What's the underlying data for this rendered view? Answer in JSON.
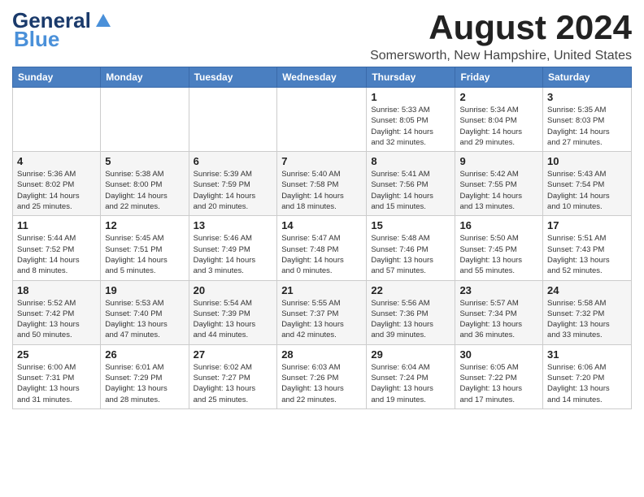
{
  "header": {
    "logo_line1": "General",
    "logo_line2": "Blue",
    "month": "August 2024",
    "location": "Somersworth, New Hampshire, United States"
  },
  "days_of_week": [
    "Sunday",
    "Monday",
    "Tuesday",
    "Wednesday",
    "Thursday",
    "Friday",
    "Saturday"
  ],
  "weeks": [
    [
      {
        "day": "",
        "info": ""
      },
      {
        "day": "",
        "info": ""
      },
      {
        "day": "",
        "info": ""
      },
      {
        "day": "",
        "info": ""
      },
      {
        "day": "1",
        "info": "Sunrise: 5:33 AM\nSunset: 8:05 PM\nDaylight: 14 hours\nand 32 minutes."
      },
      {
        "day": "2",
        "info": "Sunrise: 5:34 AM\nSunset: 8:04 PM\nDaylight: 14 hours\nand 29 minutes."
      },
      {
        "day": "3",
        "info": "Sunrise: 5:35 AM\nSunset: 8:03 PM\nDaylight: 14 hours\nand 27 minutes."
      }
    ],
    [
      {
        "day": "4",
        "info": "Sunrise: 5:36 AM\nSunset: 8:02 PM\nDaylight: 14 hours\nand 25 minutes."
      },
      {
        "day": "5",
        "info": "Sunrise: 5:38 AM\nSunset: 8:00 PM\nDaylight: 14 hours\nand 22 minutes."
      },
      {
        "day": "6",
        "info": "Sunrise: 5:39 AM\nSunset: 7:59 PM\nDaylight: 14 hours\nand 20 minutes."
      },
      {
        "day": "7",
        "info": "Sunrise: 5:40 AM\nSunset: 7:58 PM\nDaylight: 14 hours\nand 18 minutes."
      },
      {
        "day": "8",
        "info": "Sunrise: 5:41 AM\nSunset: 7:56 PM\nDaylight: 14 hours\nand 15 minutes."
      },
      {
        "day": "9",
        "info": "Sunrise: 5:42 AM\nSunset: 7:55 PM\nDaylight: 14 hours\nand 13 minutes."
      },
      {
        "day": "10",
        "info": "Sunrise: 5:43 AM\nSunset: 7:54 PM\nDaylight: 14 hours\nand 10 minutes."
      }
    ],
    [
      {
        "day": "11",
        "info": "Sunrise: 5:44 AM\nSunset: 7:52 PM\nDaylight: 14 hours\nand 8 minutes."
      },
      {
        "day": "12",
        "info": "Sunrise: 5:45 AM\nSunset: 7:51 PM\nDaylight: 14 hours\nand 5 minutes."
      },
      {
        "day": "13",
        "info": "Sunrise: 5:46 AM\nSunset: 7:49 PM\nDaylight: 14 hours\nand 3 minutes."
      },
      {
        "day": "14",
        "info": "Sunrise: 5:47 AM\nSunset: 7:48 PM\nDaylight: 14 hours\nand 0 minutes."
      },
      {
        "day": "15",
        "info": "Sunrise: 5:48 AM\nSunset: 7:46 PM\nDaylight: 13 hours\nand 57 minutes."
      },
      {
        "day": "16",
        "info": "Sunrise: 5:50 AM\nSunset: 7:45 PM\nDaylight: 13 hours\nand 55 minutes."
      },
      {
        "day": "17",
        "info": "Sunrise: 5:51 AM\nSunset: 7:43 PM\nDaylight: 13 hours\nand 52 minutes."
      }
    ],
    [
      {
        "day": "18",
        "info": "Sunrise: 5:52 AM\nSunset: 7:42 PM\nDaylight: 13 hours\nand 50 minutes."
      },
      {
        "day": "19",
        "info": "Sunrise: 5:53 AM\nSunset: 7:40 PM\nDaylight: 13 hours\nand 47 minutes."
      },
      {
        "day": "20",
        "info": "Sunrise: 5:54 AM\nSunset: 7:39 PM\nDaylight: 13 hours\nand 44 minutes."
      },
      {
        "day": "21",
        "info": "Sunrise: 5:55 AM\nSunset: 7:37 PM\nDaylight: 13 hours\nand 42 minutes."
      },
      {
        "day": "22",
        "info": "Sunrise: 5:56 AM\nSunset: 7:36 PM\nDaylight: 13 hours\nand 39 minutes."
      },
      {
        "day": "23",
        "info": "Sunrise: 5:57 AM\nSunset: 7:34 PM\nDaylight: 13 hours\nand 36 minutes."
      },
      {
        "day": "24",
        "info": "Sunrise: 5:58 AM\nSunset: 7:32 PM\nDaylight: 13 hours\nand 33 minutes."
      }
    ],
    [
      {
        "day": "25",
        "info": "Sunrise: 6:00 AM\nSunset: 7:31 PM\nDaylight: 13 hours\nand 31 minutes."
      },
      {
        "day": "26",
        "info": "Sunrise: 6:01 AM\nSunset: 7:29 PM\nDaylight: 13 hours\nand 28 minutes."
      },
      {
        "day": "27",
        "info": "Sunrise: 6:02 AM\nSunset: 7:27 PM\nDaylight: 13 hours\nand 25 minutes."
      },
      {
        "day": "28",
        "info": "Sunrise: 6:03 AM\nSunset: 7:26 PM\nDaylight: 13 hours\nand 22 minutes."
      },
      {
        "day": "29",
        "info": "Sunrise: 6:04 AM\nSunset: 7:24 PM\nDaylight: 13 hours\nand 19 minutes."
      },
      {
        "day": "30",
        "info": "Sunrise: 6:05 AM\nSunset: 7:22 PM\nDaylight: 13 hours\nand 17 minutes."
      },
      {
        "day": "31",
        "info": "Sunrise: 6:06 AM\nSunset: 7:20 PM\nDaylight: 13 hours\nand 14 minutes."
      }
    ]
  ]
}
